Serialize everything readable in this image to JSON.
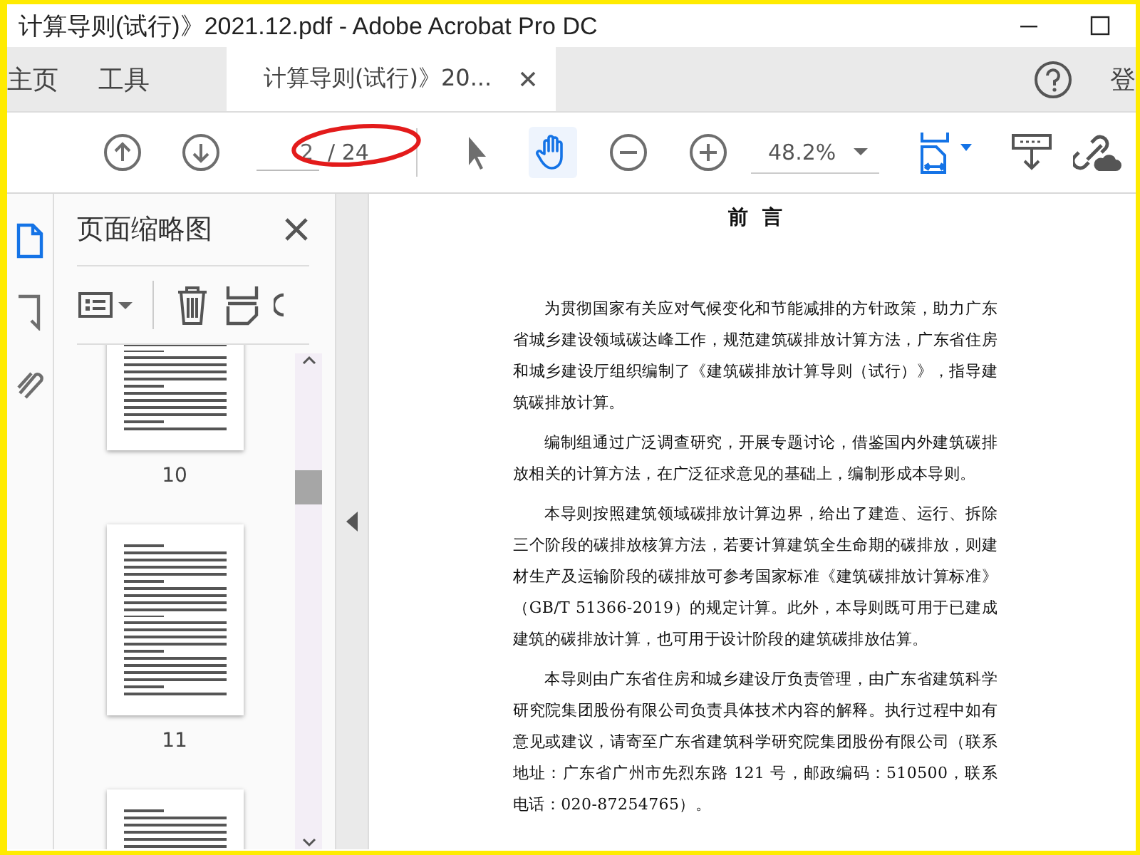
{
  "window": {
    "title": "计算导则(试行)》2021.12.pdf - Adobe Acrobat Pro DC"
  },
  "tabs": [
    {
      "label": "主页",
      "selected": false,
      "closable": false
    },
    {
      "label": "工具",
      "selected": false,
      "closable": false
    },
    {
      "label": "计算导则(试行)》20...",
      "selected": true,
      "closable": true
    }
  ],
  "account_label": "登",
  "toolbar": {
    "page_field": {
      "value": "2"
    },
    "page_total": "/ 24",
    "zoom": "48.2%",
    "tools": [
      {
        "kind": "select",
        "selected": false
      },
      {
        "kind": "hand",
        "selected": true
      }
    ]
  },
  "left_rail": [
    {
      "kind": "pages",
      "selected": true
    },
    {
      "kind": "bookmark",
      "selected": false
    },
    {
      "kind": "attachment",
      "selected": false
    }
  ],
  "thumbnail_panel": {
    "title": "页面缩略图",
    "thumbnails": [
      {
        "label": "10"
      },
      {
        "label": "11"
      }
    ],
    "next_thumbnail_visible": true
  },
  "document": {
    "heading": "前  言",
    "paragraphs": [
      "为贯彻国家有关应对气候变化和节能减排的方针政策，助力广东省城乡建设领域碳达峰工作，规范建筑碳排放计算方法，广东省住房和城乡建设厅组织编制了《建筑碳排放计算导则（试行）》，指导建筑碳排放计算。",
      "编制组通过广泛调查研究，开展专题讨论，借鉴国内外建筑碳排放相关的计算方法，在广泛征求意见的基础上，编制形成本导则。",
      "本导则按照建筑领域碳排放计算边界，给出了建造、运行、拆除三个阶段的碳排放核算方法，若要计算建筑全生命期的碳排放，则建材生产及运输阶段的碳排放可参考国家标准《建筑碳排放计算标准》（GB/T 51366-2019）的规定计算。此外，本导则既可用于已建成建筑的碳排放计算，也可用于设计阶段的建筑碳排放估算。",
      "本导则由广东省住房和城乡建设厅负责管理，由广东省建筑科学研究院集团股份有限公司负责具体技术内容的解释。执行过程中如有意见或建议，请寄至广东省建筑科学研究院集团股份有限公司（联系地址：广东省广州市先烈东路 121 号，邮政编码：510500，联系电话：020-87254765）。"
    ]
  }
}
